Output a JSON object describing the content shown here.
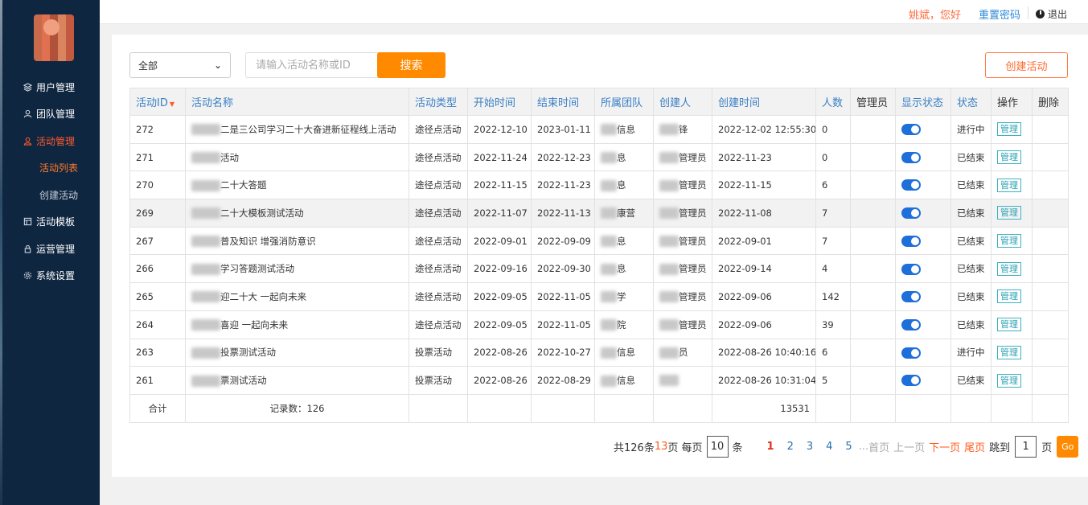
{
  "header": {
    "greeting": "姚斌，您好",
    "reset_password": "重置密码",
    "logout": "退出"
  },
  "sidebar": {
    "items": [
      {
        "label": "用户管理",
        "icon": "layers-icon"
      },
      {
        "label": "团队管理",
        "icon": "team-icon"
      },
      {
        "label": "活动管理",
        "icon": "user-icon",
        "active": true
      },
      {
        "label": "活动模板",
        "icon": "template-icon"
      },
      {
        "label": "运营管理",
        "icon": "lock-icon"
      },
      {
        "label": "系统设置",
        "icon": "gear-icon"
      }
    ],
    "sub_items": [
      {
        "label": "活动列表",
        "active": true
      },
      {
        "label": "创建活动"
      }
    ]
  },
  "toolbar": {
    "type_select": "全部",
    "search_placeholder": "请输入活动名称或ID",
    "search_button": "搜索",
    "create_button": "创建活动"
  },
  "table": {
    "columns": [
      "活动ID",
      "活动名称",
      "活动类型",
      "开始时间",
      "结束时间",
      "所属团队",
      "创建人",
      "创建时间",
      "人数",
      "管理员",
      "显示状态",
      "状态",
      "操作",
      "删除"
    ],
    "rows": [
      {
        "id": "272",
        "name": "二是三公司学习二十大奋进新征程线上活动",
        "type": "途径点活动",
        "start": "2022-12-10",
        "end": "2023-01-11",
        "team": "信息",
        "creator": "锋",
        "created": "2022-12-02 12:55:30",
        "count": "0",
        "status": "进行中",
        "op": "管理"
      },
      {
        "id": "271",
        "name": "活动",
        "type": "途径点活动",
        "start": "2022-11-24",
        "end": "2022-12-23",
        "team": "息",
        "creator": "管理员",
        "created": "2022-11-23",
        "count": "0",
        "status": "已结束",
        "op": "管理"
      },
      {
        "id": "270",
        "name": "二十大答题",
        "type": "途径点活动",
        "start": "2022-11-15",
        "end": "2022-11-23",
        "team": "息",
        "creator": "管理员",
        "created": "2022-11-15",
        "count": "6",
        "status": "已结束",
        "op": "管理"
      },
      {
        "id": "269",
        "name": "二十大模板测试活动",
        "type": "途径点活动",
        "start": "2022-11-07",
        "end": "2022-11-13",
        "team": "康营",
        "creator": "管理员",
        "created": "2022-11-08",
        "count": "7",
        "status": "已结束",
        "op": "管理"
      },
      {
        "id": "267",
        "name": "普及知识 增强消防意识",
        "type": "途径点活动",
        "start": "2022-09-01",
        "end": "2022-09-09",
        "team": "息",
        "creator": "管理员",
        "created": "2022-09-01",
        "count": "7",
        "status": "已结束",
        "op": "管理"
      },
      {
        "id": "266",
        "name": "学习答题测试活动",
        "type": "途径点活动",
        "start": "2022-09-16",
        "end": "2022-09-30",
        "team": "息",
        "creator": "管理员",
        "created": "2022-09-14",
        "count": "4",
        "status": "已结束",
        "op": "管理"
      },
      {
        "id": "265",
        "name": "迎二十大 一起向未来",
        "type": "途径点活动",
        "start": "2022-09-05",
        "end": "2022-11-05",
        "team": "学",
        "creator": "管理员",
        "created": "2022-09-06",
        "count": "142",
        "status": "已结束",
        "op": "管理"
      },
      {
        "id": "264",
        "name": "喜迎 一起向未来",
        "type": "途径点活动",
        "start": "2022-09-05",
        "end": "2022-11-05",
        "team": "院",
        "creator": "管理员",
        "created": "2022-09-06",
        "count": "39",
        "status": "已结束",
        "op": "管理"
      },
      {
        "id": "263",
        "name": "投票测试活动",
        "type": "投票活动",
        "start": "2022-08-26",
        "end": "2022-10-27",
        "team": "信息",
        "creator": "员",
        "created": "2022-08-26 10:40:16",
        "count": "6",
        "status": "进行中",
        "op": "管理"
      },
      {
        "id": "261",
        "name": "票测试活动",
        "type": "投票活动",
        "start": "2022-08-26",
        "end": "2022-08-29",
        "team": "信息",
        "creator": "",
        "created": "2022-08-26 10:31:04",
        "count": "5",
        "status": "已结束",
        "op": "管理"
      }
    ],
    "total_label": "合计",
    "record_count": "记录数：126",
    "total_people": "13531"
  },
  "pagination": {
    "total_prefix": "共126条",
    "total_pages": "13",
    "pages_suffix": "页 每页",
    "page_size": "10",
    "items_suffix": "条",
    "pages": [
      "1",
      "2",
      "3",
      "4",
      "5"
    ],
    "ellipsis": "...",
    "first": "首页",
    "prev": "上一页",
    "next": "下一页",
    "last": "尾页",
    "jump_label": "跳到",
    "jump_value": "1",
    "page_suffix": "页",
    "go": "Go"
  },
  "colors": {
    "sidebar_bg": "#0f2640",
    "accent_orange": "#ff8a00",
    "link_blue": "#3a7fc4",
    "toggle_blue": "#1e6fd9"
  }
}
